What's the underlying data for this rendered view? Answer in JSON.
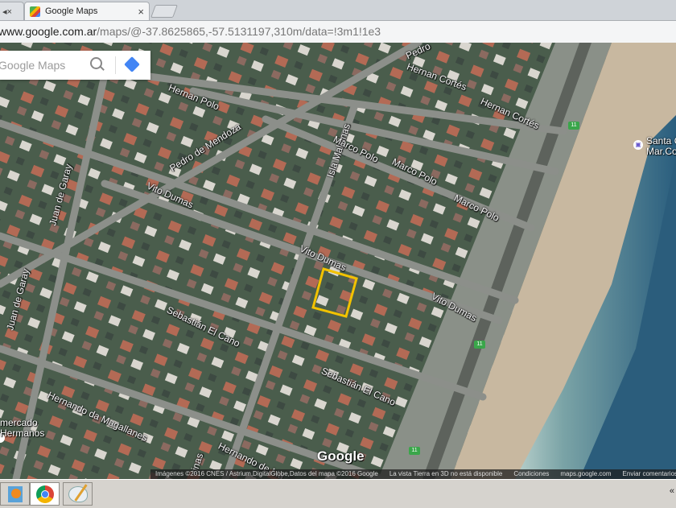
{
  "browser": {
    "prev_tab_icons": "◂× ",
    "active_tab": {
      "title": "Google Maps",
      "close": "×"
    },
    "url_host": "www.google.com.ar",
    "url_path": "/maps/@-37.8625865,-57.5131197,310m/data=!3m1!1e3"
  },
  "search": {
    "placeholder": "Google Maps"
  },
  "map": {
    "streets": [
      {
        "id": "pedro-top",
        "label": "Pedro"
      },
      {
        "id": "hernan-polo",
        "label": "Hernan Polo"
      },
      {
        "id": "hernan-cortes-1",
        "label": "Hernan Cortés"
      },
      {
        "id": "hernan-cortes-2",
        "label": "Hernan Cortés"
      },
      {
        "id": "isla-malvinas",
        "label": "Isla Malvinas"
      },
      {
        "id": "pedro-de-mendoza",
        "label": "Pedro de Mendoza"
      },
      {
        "id": "marco-polo-1",
        "label": "Marco Polo"
      },
      {
        "id": "marco-polo-2",
        "label": "Marco Polo"
      },
      {
        "id": "marco-polo-3",
        "label": "Marco Polo"
      },
      {
        "id": "juan-de-garay-1",
        "label": "Juan de Garay"
      },
      {
        "id": "juan-de-garay-2",
        "label": "Juan de Garay"
      },
      {
        "id": "vito-dumas-1",
        "label": "Vito Dumas"
      },
      {
        "id": "vito-dumas-2",
        "label": "Vito Dumas"
      },
      {
        "id": "vito-dumas-3",
        "label": "Vito Dumas"
      },
      {
        "id": "sebastian-el-cano-1",
        "label": "Sebastián El Cano"
      },
      {
        "id": "sebastian-el-cano-2",
        "label": "Sebastián El Cano"
      },
      {
        "id": "hernando-magallanes-1",
        "label": "Hernando da Magallanes"
      },
      {
        "id": "hernando-magallanes-2",
        "label": "Hernando de Ma"
      },
      {
        "id": "vinas",
        "label": "vinas"
      }
    ],
    "route_badges": [
      "11",
      "11",
      "11"
    ],
    "pois": [
      {
        "label": "Santa C\nMar.Co"
      },
      {
        "label": "mercado\nHermanos"
      }
    ],
    "selection_color": "#f2c200",
    "logo": "Google"
  },
  "attribution": {
    "imagery": "Imágenes ©2016 CNES / Astrium,DigitalGlobe,Datos del mapa ©2016 Google",
    "no3d": "La vista Tierra en 3D no está disponible",
    "terms": "Condiciones",
    "site": "maps.google.com",
    "feedback": "Enviar comentarios"
  },
  "taskbar": {
    "chevron": "«"
  }
}
